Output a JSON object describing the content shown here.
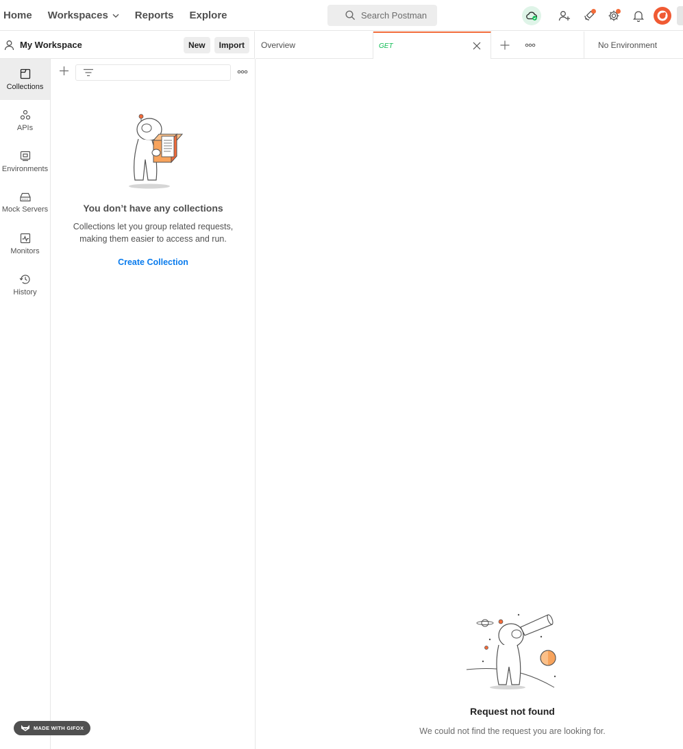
{
  "topnav": {
    "home": "Home",
    "workspaces": "Workspaces",
    "reports": "Reports",
    "explore": "Explore"
  },
  "search": {
    "placeholder": "Search Postman"
  },
  "workspace": {
    "title": "My Workspace",
    "new_label": "New",
    "import_label": "Import"
  },
  "rail": {
    "items": [
      {
        "label": "Collections",
        "icon": "collections-icon",
        "active": true
      },
      {
        "label": "APIs",
        "icon": "apis-icon"
      },
      {
        "label": "Environments",
        "icon": "environments-icon"
      },
      {
        "label": "Mock Servers",
        "icon": "mock-servers-icon"
      },
      {
        "label": "Monitors",
        "icon": "monitors-icon"
      },
      {
        "label": "History",
        "icon": "history-icon"
      }
    ]
  },
  "collections": {
    "empty_title": "You don’t have any collections",
    "empty_desc_line1": "Collections let you group related requests,",
    "empty_desc_line2": "making them easier to access and run.",
    "create_label": "Create Collection"
  },
  "tabs": {
    "overview": "Overview",
    "active_method": "GET",
    "environment": "No Environment"
  },
  "main": {
    "not_found_title": "Request not found",
    "not_found_desc": "We could not find the request you are looking for."
  },
  "badge": {
    "text": "MADE WITH GIFOX"
  },
  "colors": {
    "accent": "#f26b3a",
    "link": "#097bed",
    "method_get": "#0cbb52"
  }
}
